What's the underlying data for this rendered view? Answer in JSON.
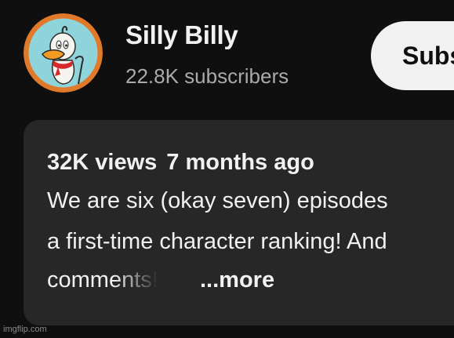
{
  "channel": {
    "name": "Silly Billy",
    "subscribers": "22.8K subscribers",
    "subscribe_label": "Subscribe"
  },
  "description": {
    "views": "32K views",
    "date": "7 months ago",
    "line1": "We are six (okay seven) episodes",
    "line2": "a first-time character ranking! And",
    "line3": "comments!",
    "more_label": "...more"
  },
  "watermark": "imgflip.com",
  "colors": {
    "background": "#0f0f0f",
    "card": "#272727",
    "text_primary": "#f1f1f1",
    "text_secondary": "#aaaaaa",
    "button_bg": "#f1f1f1"
  }
}
